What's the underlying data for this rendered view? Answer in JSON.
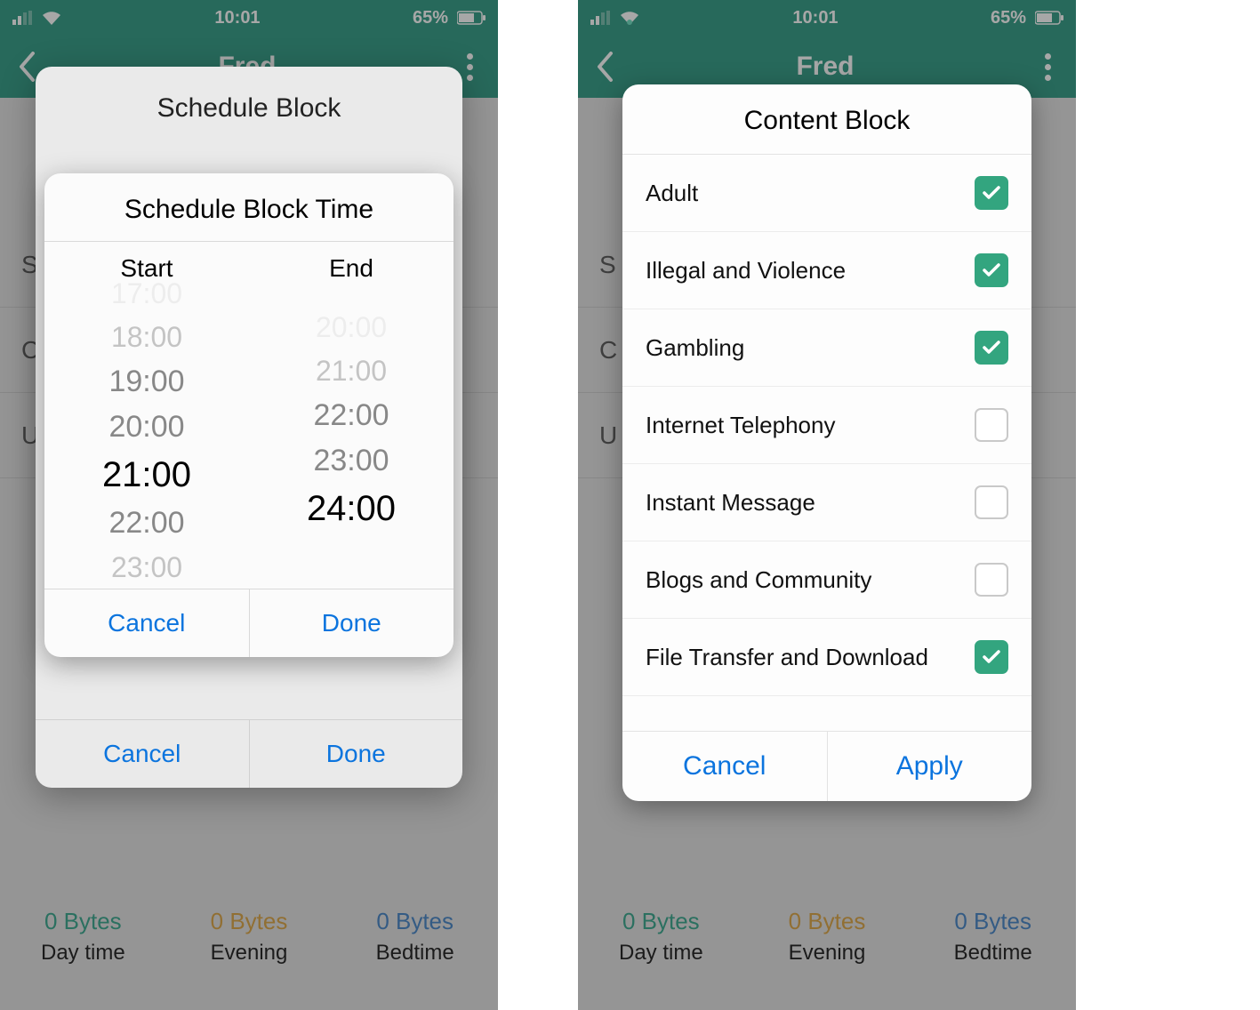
{
  "status": {
    "time": "10:01",
    "battery": "65%"
  },
  "nav": {
    "title": "Fred"
  },
  "bg": {
    "rows": [
      "S",
      "C",
      "U"
    ],
    "usage": [
      {
        "bytes": "0 Bytes",
        "label": "Day time",
        "cls": ""
      },
      {
        "bytes": "0 Bytes",
        "label": "Evening",
        "cls": "orange"
      },
      {
        "bytes": "0 Bytes",
        "label": "Bedtime",
        "cls": "blue"
      }
    ]
  },
  "left": {
    "sheet_title": "Schedule Block",
    "sheet_cancel": "Cancel",
    "sheet_done": "Done",
    "picker_title": "Schedule Block Time",
    "start_label": "Start",
    "end_label": "End",
    "start_wheel": [
      "17:00",
      "18:00",
      "19:00",
      "20:00",
      "21:00",
      "22:00",
      "23:00"
    ],
    "end_wheel": [
      "20:00",
      "21:00",
      "22:00",
      "23:00",
      "24:00",
      "",
      ""
    ],
    "picker_cancel": "Cancel",
    "picker_done": "Done"
  },
  "right": {
    "title": "Content Block",
    "items": [
      {
        "label": "Adult",
        "checked": true
      },
      {
        "label": "Illegal and Violence",
        "checked": true
      },
      {
        "label": "Gambling",
        "checked": true
      },
      {
        "label": "Internet Telephony",
        "checked": false
      },
      {
        "label": "Instant Message",
        "checked": false
      },
      {
        "label": "Blogs and Community",
        "checked": false
      },
      {
        "label": "File Transfer and Download",
        "checked": true
      }
    ],
    "cancel": "Cancel",
    "apply": "Apply"
  }
}
